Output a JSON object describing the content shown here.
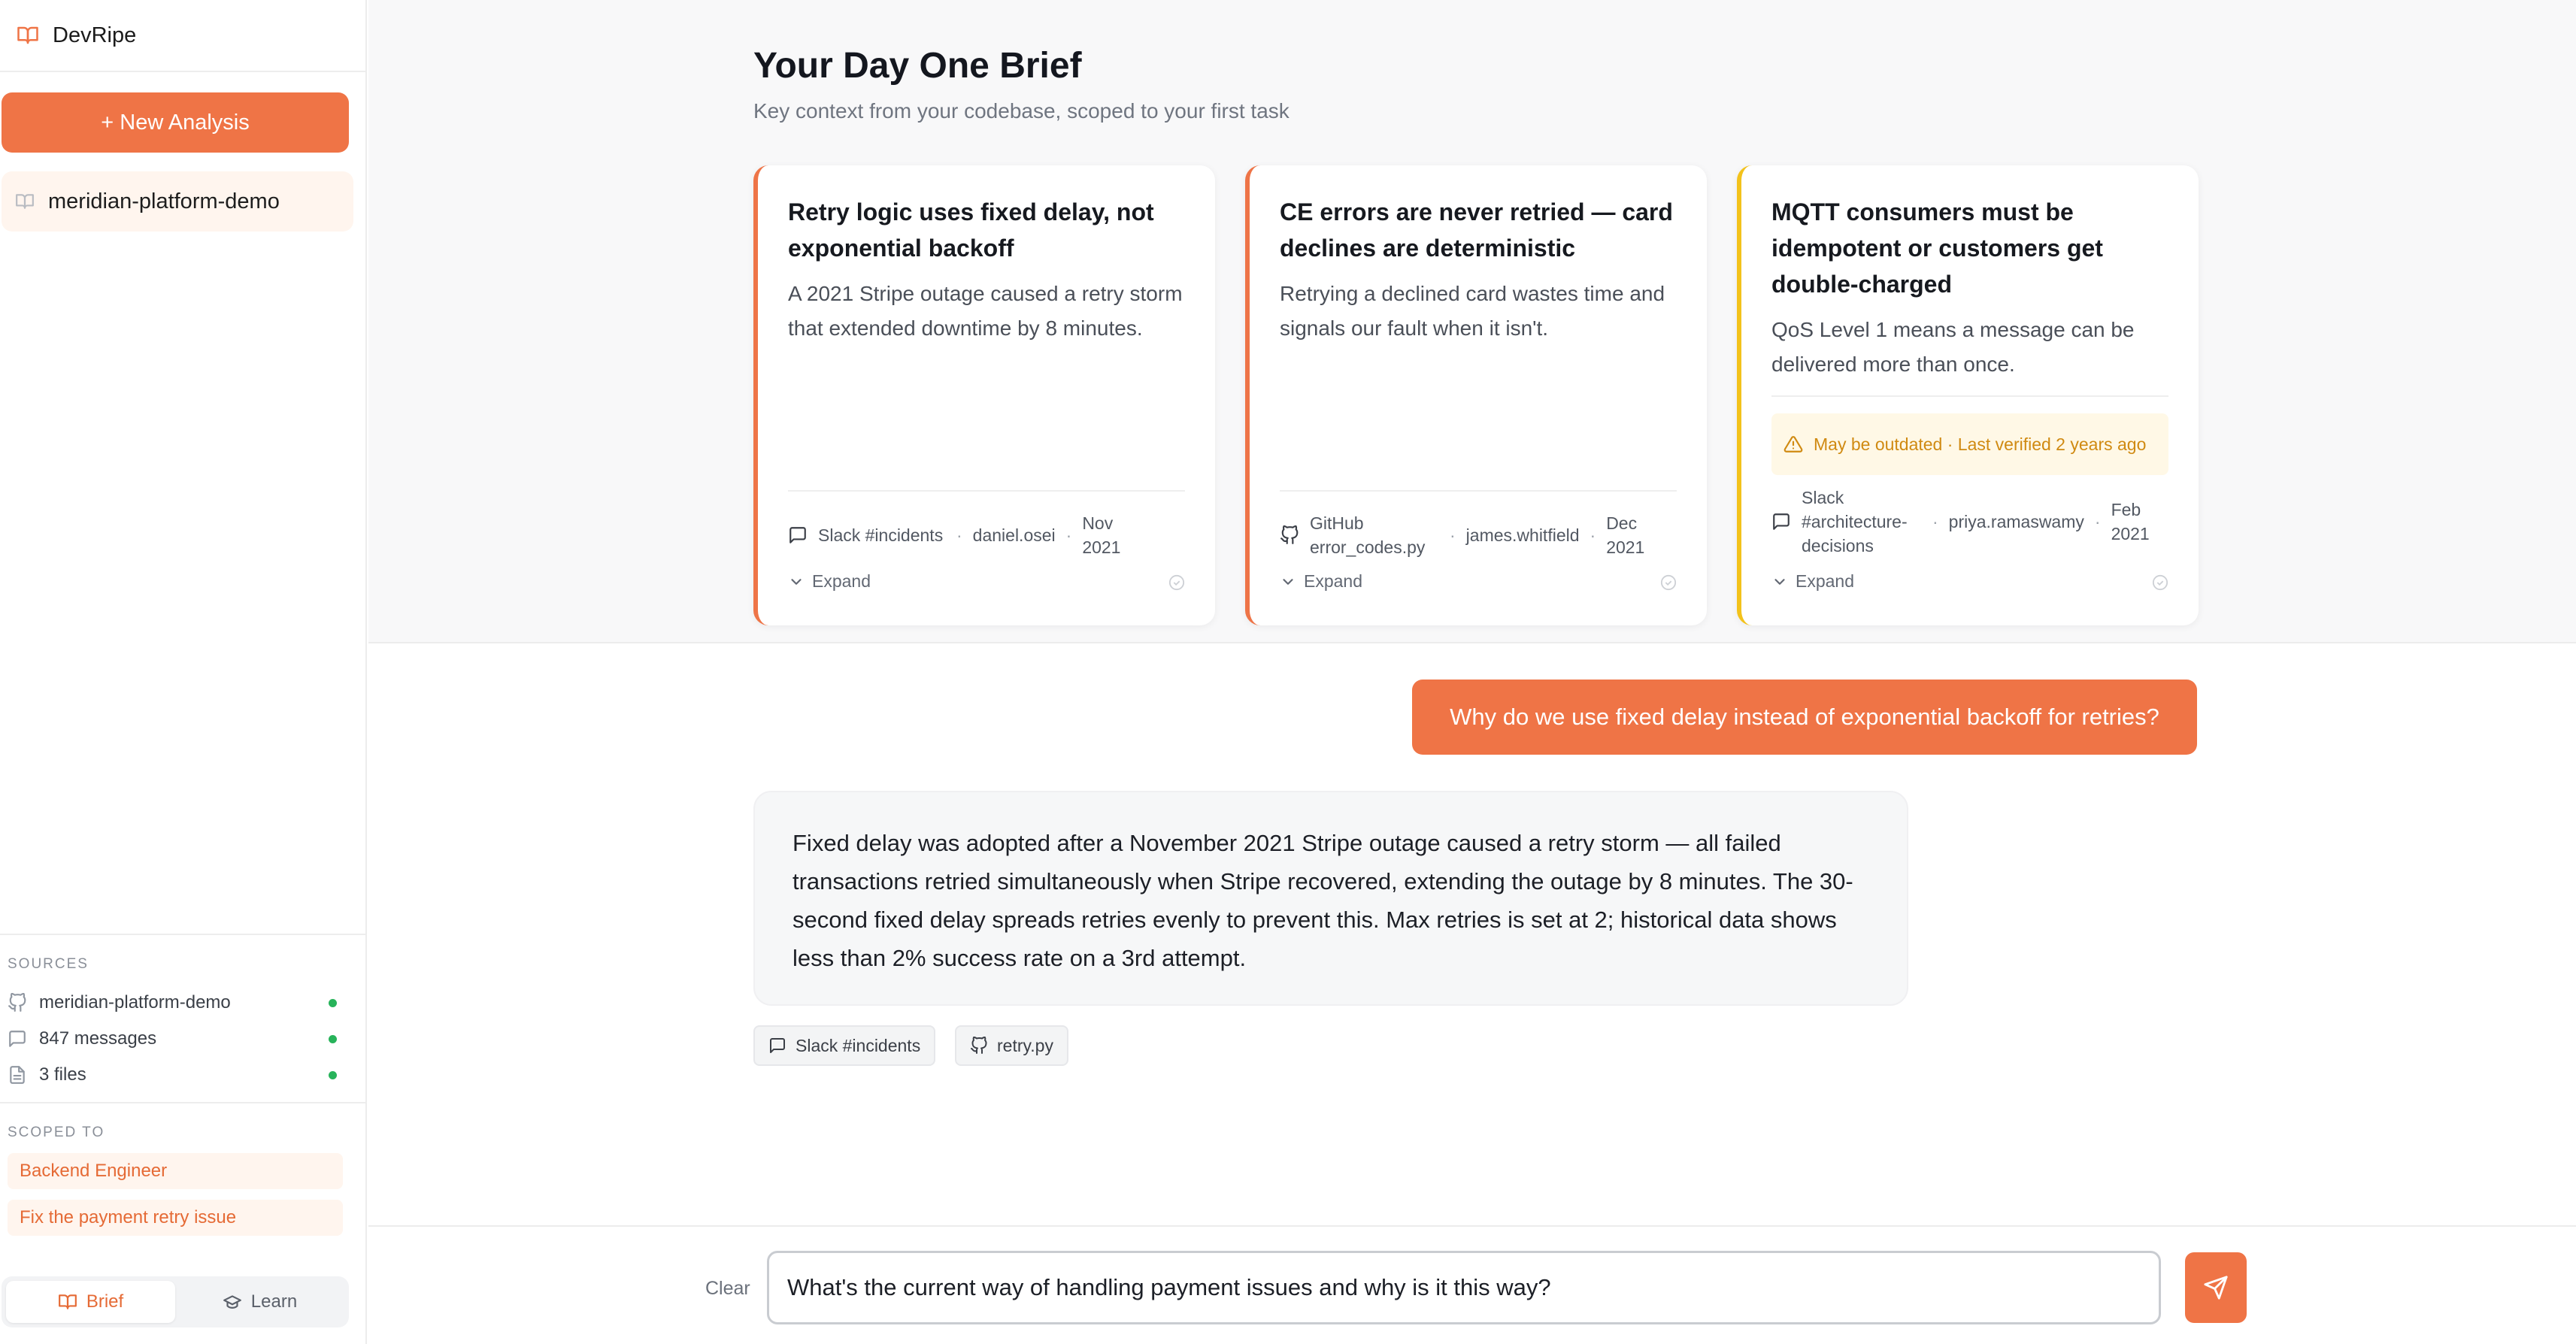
{
  "app": {
    "name": "DevRipe"
  },
  "sidebar": {
    "new_analysis_label": "+ New Analysis",
    "project": "meridian-platform-demo",
    "sources_title": "SOURCES",
    "sources": [
      {
        "label": "meridian-platform-demo",
        "icon": "github-icon",
        "status": "connected"
      },
      {
        "label": "847 messages",
        "icon": "message-icon",
        "status": "connected"
      },
      {
        "label": "3 files",
        "icon": "file-icon",
        "status": "connected"
      }
    ],
    "scoped_title": "SCOPED TO",
    "scopes": [
      "Backend Engineer",
      "Fix the payment retry issue"
    ],
    "modes": {
      "brief": "Brief",
      "learn": "Learn",
      "active": "Brief"
    }
  },
  "brief": {
    "title": "Your Day One Brief",
    "subtitle": "Key context from your codebase, scoped to your first task",
    "cards": [
      {
        "title": "Retry logic uses fixed delay, not exponential backoff",
        "description": "A 2021 Stripe outage caused a retry storm that extended downtime by 8 minutes.",
        "source": "Slack #incidents",
        "author": "daniel.osei",
        "date": "Nov 2021",
        "expand": "Expand",
        "accent": "#ee7447"
      },
      {
        "title": "CE errors are never retried — card declines are deterministic",
        "description": "Retrying a declined card wastes time and signals our fault when it isn't.",
        "source": "GitHub error_codes.py",
        "author": "james.whitfield",
        "date": "Dec 2021",
        "expand": "Expand",
        "accent": "#ee7447"
      },
      {
        "title": "MQTT consumers must be idempotent or customers get double-charged",
        "description": "QoS Level 1 means a message can be delivered more than once.",
        "warning": "May be outdated · Last verified 2 years ago",
        "source": "Slack #architecture-decisions",
        "author": "priya.ramaswamy",
        "date": "Feb 2021",
        "expand": "Expand",
        "accent": "#f3c21b"
      }
    ]
  },
  "chat": {
    "user_message": "Why do we use fixed delay instead of exponential backoff for retries?",
    "answer": "Fixed delay was adopted after a November 2021 Stripe outage caused a retry storm — all failed transactions retried simultaneously when Stripe recovered, extending the outage by 8 minutes. The 30-second fixed delay spreads retries evenly to prevent this. Max retries is set at 2; historical data shows less than 2% success rate on a 3rd attempt.",
    "citations": [
      "Slack #incidents",
      "retry.py"
    ]
  },
  "composer": {
    "clear_label": "Clear",
    "input_value": "What's the current way of handling payment issues and why is it this way?"
  },
  "colors": {
    "accent": "#ef7446",
    "warning": "#d08a12",
    "status_ok": "#27b35a"
  }
}
